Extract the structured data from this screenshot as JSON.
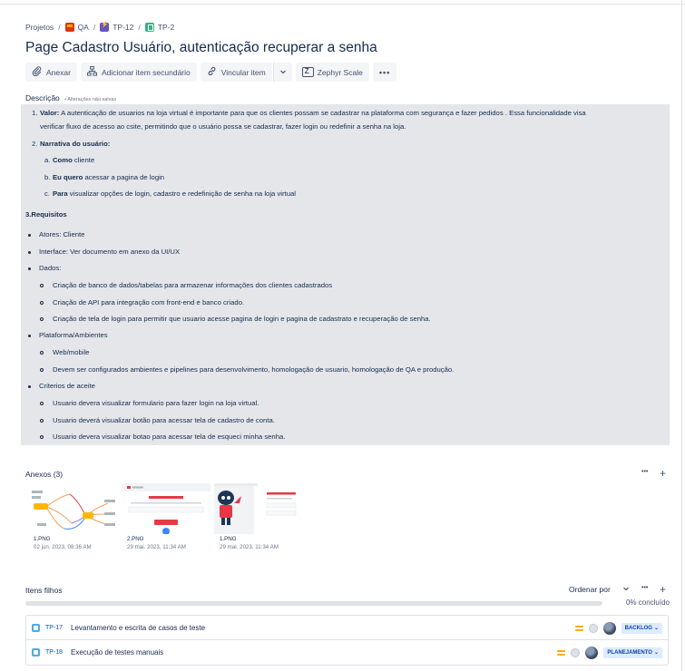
{
  "breadcrumb": {
    "items": [
      "Projetos",
      "QA",
      "TP-12",
      "TP-2"
    ],
    "separator": "/"
  },
  "issue": {
    "title": "Page Cadastro Usuário, autenticação recuperar a senha"
  },
  "toolbar": {
    "attach_label": "Anexar",
    "add_child_label": "Adicionar item secundário",
    "link_label": "Vincular item",
    "zephyr_label": "Zephyr Scale",
    "more_label": "•••"
  },
  "description": {
    "label": "Descrição",
    "unsaved_label": "• Alterações não salvas",
    "item1_num": "1.",
    "item1_bold": "Valor:",
    "item1_text_a": " A autenticação de usuarios na loja virtual é importante para que os clientes possam se cadastrar na plataforma com segurança e fazer pedidos . Essa funcionalidade visa",
    "item1_text_b": "verificar fluxo de acesso ao csite, permitindo que o usuário possa se cadastrar, fazer login ou redefinir a senha na loja.",
    "item2_num": "2.",
    "item2_bold": "Narrativa do usuário:",
    "item2a_letter": "a.",
    "item2a_bold": "Como",
    "item2a_text": " cliente",
    "item2b_letter": "b.",
    "item2b_bold": "Eu quero",
    "item2b_text": " acessar a pagina de login",
    "item2c_letter": "c.",
    "item2c_bold": "Para",
    "item2c_text": " visualizar opções de login, cadastro e redefinição de senha na loja virtual",
    "req_heading": "3.Requisitos",
    "atores": "Atores: Cliente",
    "interface": "Interface: Ver documento em anexo da UI/UX",
    "dados": "Dados:",
    "dados_items": [
      "Criação de banco de dados/tabelas para armazenar informações dos clientes cadastrados",
      "Criação de API para integração com front-end e banco criado.",
      "Criação de tela de login para permitir que usuario acesse pagina de login e pagina de cadastrato e recuperação de senha."
    ],
    "plataforma": "Plataforma/Ambientes",
    "plataforma_items": [
      "Web/mobile",
      "Devem ser configurados ambientes e pipelines para desenvolvimento, homologação de usuario, homologação de QA e produção."
    ],
    "criterios": "Criterios de aceite",
    "criterios_items": [
      "Usuario devera visualizar formulario para fazer login na loja virtual.",
      "Usuario deverá visualizar botão para acessar tela de cadastro de conta.",
      "Usuario devera visualizar botao para acessar tela de esqueci minha senha."
    ]
  },
  "attachments": {
    "label": "Anexos (3)",
    "more_label": "•••",
    "add_label": "+",
    "items": [
      {
        "name": "1.PNG",
        "date": "02 jun. 2023, 08:36 AM"
      },
      {
        "name": "2.PNG",
        "date": "29 mai. 2023, 11:34 AM"
      },
      {
        "name": "1.PNG",
        "date": "29 mai. 2023, 11:34 AM"
      }
    ]
  },
  "children": {
    "label": "Itens filhos",
    "sort_label": "Ordenar por",
    "more_label": "•••",
    "add_label": "+",
    "progress_percent": 0,
    "progress_label": "0% concluído",
    "items": [
      {
        "key": "TP-17",
        "summary": "Levantamento e escrita de casos de teste",
        "status": "BACKLOG"
      },
      {
        "key": "TP-18",
        "summary": "Execução de testes manuais",
        "status": "PLANEJAMENTO"
      }
    ]
  },
  "colors": {
    "accent": "#0052cc",
    "progress": "#0065ff",
    "description_bg": "#e4e6ea",
    "status_bg": "#deebff",
    "priority": "#ffab00"
  },
  "icons": {
    "attach": "paperclip-icon",
    "add_child": "hierarchy-icon",
    "link": "link-icon",
    "zephyr": "zephyr-icon",
    "task": "task-icon",
    "priority": "priority-medium-icon"
  }
}
